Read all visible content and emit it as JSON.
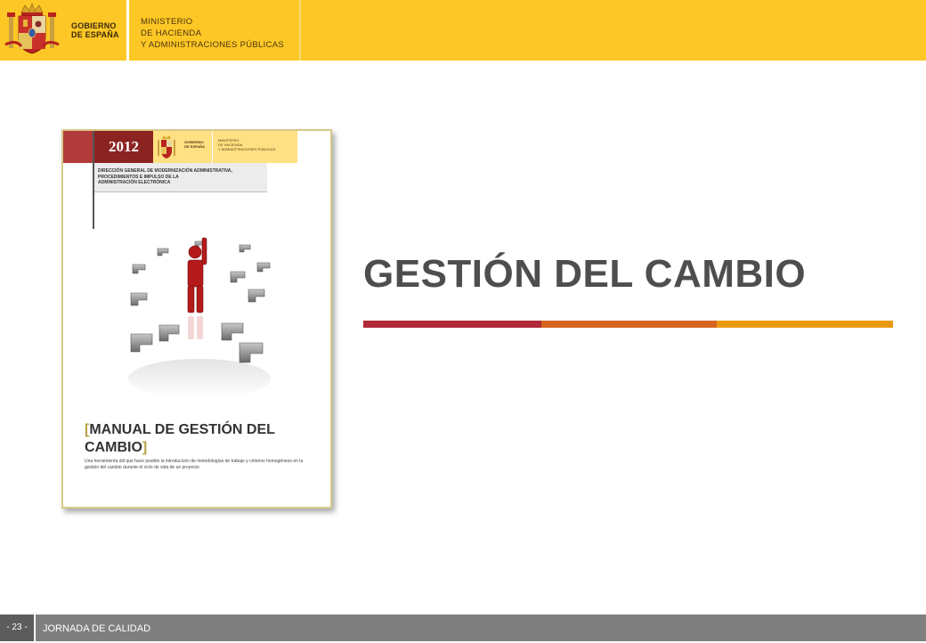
{
  "header": {
    "government_line1": "GOBIERNO",
    "government_line2": "DE ESPAÑA",
    "ministry_line1": "MINISTERIO",
    "ministry_line2": "DE HACIENDA",
    "ministry_line3": "Y ADMINISTRACIONES PÚBLICAS",
    "background_color": "#fdc725"
  },
  "cover": {
    "year": "2012",
    "gov_line1": "GOBIERNO",
    "gov_line2": "DE ESPAÑA",
    "ministry_line1": "MINISTERIO",
    "ministry_line2": "DE HACIENDA",
    "ministry_line3": "Y ADMINISTRACIONES PÚBLICAS",
    "directorate_line1": "DIRECCIÓN GENERAL DE MODERNIZACIÓN ADMINISTRATIVA,",
    "directorate_line2": "PROCEDIMIENTOS E IMPULSO DE LA",
    "directorate_line3": "ADMINISTRACIÓN ELECTRÓNICA",
    "bracket_open": "[",
    "title_line1": "MANUAL DE GESTIÓN DEL",
    "title_line2": "CAMBIO",
    "bracket_close": "]",
    "description": "Una herramienta útil que hace posible la introducción de metodologías de trabajo y criterios homogéneos en la gestión del cambio durante el ciclo de vida de un proyecto"
  },
  "slide": {
    "title": "GESTIÓN DEL CAMBIO",
    "rule_colors": [
      "#b02a3a",
      "#d4651e",
      "#e89b12"
    ]
  },
  "footer": {
    "page_number": "- 23 -",
    "event": "JORNADA DE CALIDAD"
  }
}
